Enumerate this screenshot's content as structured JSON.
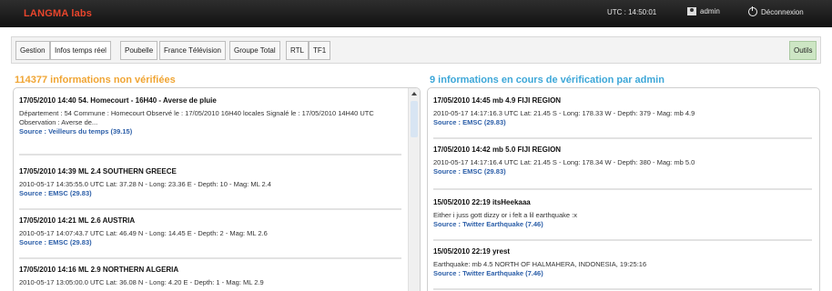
{
  "header": {
    "brand": "LANGMA labs",
    "utc": "UTC : 14:50:01",
    "user": "admin",
    "logout": "Déconnexion"
  },
  "tabs": [
    {
      "label": "Gestion",
      "active": false
    },
    {
      "label": "Infos temps réel",
      "active": true
    },
    {
      "label": "Poubelle",
      "active": false
    },
    {
      "label": "France Télévision",
      "active": false
    },
    {
      "label": "Groupe Total",
      "active": false
    },
    {
      "label": "RTL",
      "active": false
    },
    {
      "label": "TF1",
      "active": false
    }
  ],
  "tools_tab": "Outils",
  "left_heading": "114377 informations non vérifiées",
  "right_heading": "9 informations en cours de vérification par admin",
  "left_items": [
    {
      "title": "17/05/2010 14:40 54. Homecourt - 16H40 - Averse de pluie",
      "body": "Département : 54 Commune : Homecourt Observé le : 17/05/2010 16H40 locales Signalé le : 17/05/2010 14H40 UTC Observation : Averse de...",
      "source": "Source : Veilleurs du temps (39.15)"
    },
    {
      "title": "17/05/2010 14:39 ML 2.4 SOUTHERN GREECE",
      "body": "2010-05-17 14:35:55.0 UTC Lat: 37.28 N - Long: 23.36 E - Depth: 10 - Mag: ML 2.4",
      "source": "Source : EMSC (29.83)"
    },
    {
      "title": "17/05/2010 14:21 ML 2.6 AUSTRIA",
      "body": "2010-05-17 14:07:43.7 UTC Lat: 46.49 N - Long: 14.45 E - Depth: 2 - Mag: ML 2.6",
      "source": "Source : EMSC (29.83)"
    },
    {
      "title": "17/05/2010 14:16 ML 2.9 NORTHERN ALGERIA",
      "body": "2010-05-17 13:05:00.0 UTC Lat: 36.08 N - Long: 4.20 E - Depth: 1 - Mag: ML 2.9",
      "source": ""
    }
  ],
  "right_items": [
    {
      "title": "17/05/2010 14:45 mb 4.9 FIJI REGION",
      "body": "2010-05-17 14:17:16.3 UTC Lat: 21.45 S - Long: 178.33 W - Depth: 379 - Mag: mb 4.9",
      "source": "Source : EMSC (29.83)"
    },
    {
      "title": "17/05/2010 14:42 mb 5.0 FIJI REGION",
      "body": "2010-05-17 14:17:16.4 UTC Lat: 21.45 S - Long: 178.34 W - Depth: 380 - Mag: mb 5.0",
      "source": "Source : EMSC (29.83)"
    },
    {
      "title": "15/05/2010 22:19 itsHeekaaa",
      "body": "Either i juss gott dizzy or i felt a lil earthquake :x",
      "source": "Source : Twitter Earthquake (7.46)"
    },
    {
      "title": "15/05/2010 22:19 yrest",
      "body": "Earthquake: mb 4.5 NORTH OF HALMAHERA, INDONESIA, 19:25:16",
      "source": "Source : Twitter Earthquake (7.46)"
    }
  ]
}
